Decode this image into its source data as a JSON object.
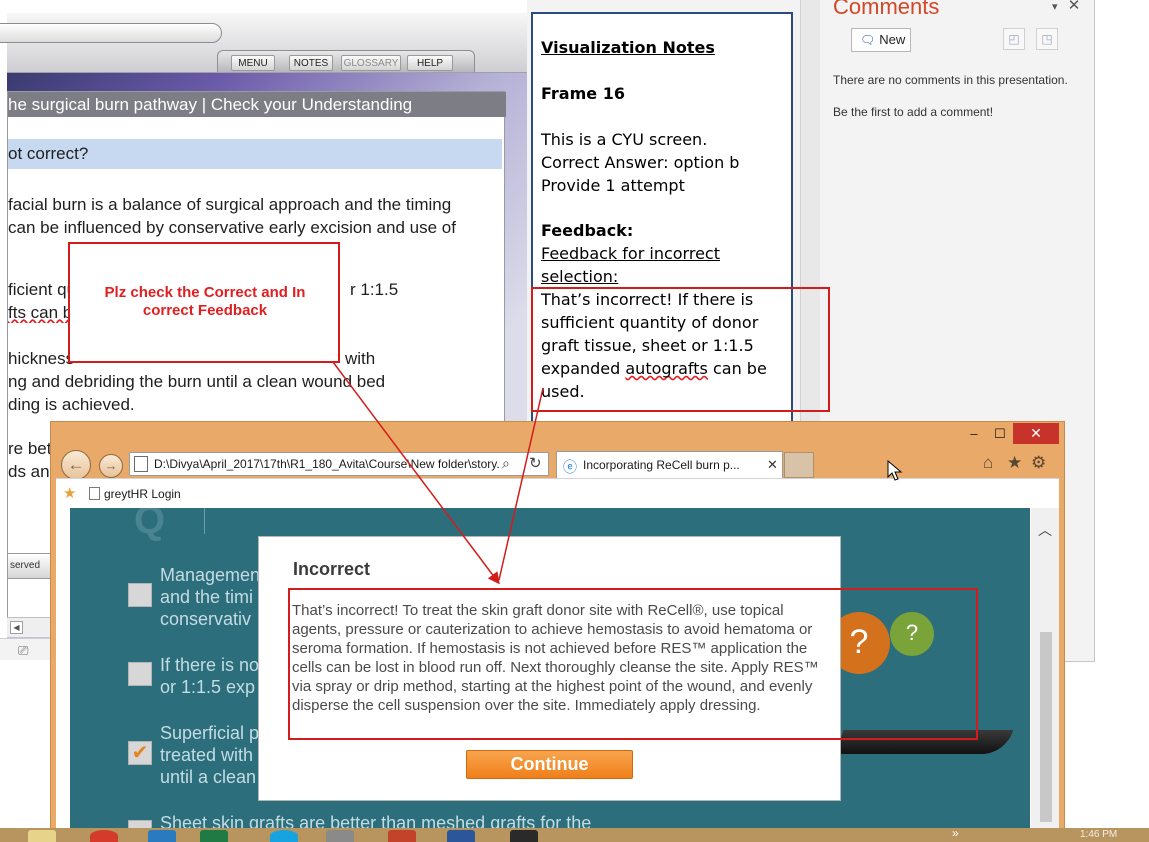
{
  "player": {
    "nav": {
      "menu": "MENU",
      "notes": "NOTES",
      "glossary": "GLOSSARY",
      "help": "HELP"
    },
    "slide_title": "he surgical burn pathway | Check your Understanding",
    "question_text": "ot correct?",
    "text_lines": [
      " facial burn is a balance of surgical approach and the timing",
      "can be influenced by conservative early excision and use of",
      "ficient qu",
      "r 1:1.5",
      "fts can b",
      "hickness",
      "with",
      "ng and debriding the burn until a clean wound bed",
      "ding is achieved.",
      "re bet",
      "ds and"
    ],
    "footer_text": "served"
  },
  "notes": {
    "heading": "Visualization Notes",
    "frame": "Frame 16",
    "line1": "This is a CYU screen.",
    "line2": "Correct Answer: option b",
    "line3": "Provide 1 attempt",
    "feedback_label": "Feedback:",
    "feedback_sub_1": "Feedback for incorrect",
    "feedback_sub_2": "selection:",
    "body_1": "That’s incorrect! If there is",
    "body_2": "sufficient quantity of donor",
    "body_3": "graft tissue, sheet or 1:1.5",
    "body_4a": "expanded ",
    "body_4b": "autografts",
    "body_4c": " can be",
    "body_5": "used."
  },
  "comments": {
    "title": "Comments",
    "new_label": "New",
    "empty_msg": "There are no comments in this presentation.",
    "prompt_msg": "Be the first to add a comment!"
  },
  "annotation": {
    "text": "Plz check the Correct and In correct Feedback"
  },
  "browser": {
    "address": "D:\\Divya\\April_2017\\17th\\R1_180_Avita\\Course\\New folder\\story.",
    "tab_title": "Incorporating ReCell burn p...",
    "favorite": "greytHR Login"
  },
  "course": {
    "options": [
      {
        "line1": "Managemen",
        "line2": "and the timi",
        "line3": "conservativ",
        "checked": false
      },
      {
        "line1": "If there is no",
        "line2": "or 1:1.5 exp",
        "checked": false
      },
      {
        "line1": "Superficial p",
        "line2": "treated with",
        "line3": "until a clean",
        "checked": true
      },
      {
        "line1": "Sheet skin grafts are better than meshed grafts for the",
        "checked": false
      }
    ]
  },
  "dialog": {
    "title": "Incorrect",
    "body": "That’s incorrect! To treat the skin graft donor site with ReCell®, use topical agents, pressure or cauterization to achieve hemostasis to avoid hematoma or seroma formation. If hemostasis is not achieved before RES™ application the cells can be lost in blood run off. Next thoroughly cleanse the site. Apply RES™ via spray or drip method, starting at the highest point of the wound, and evenly disperse the cell suspension over the site. Immediately apply dressing.",
    "continue_label": "Continue"
  },
  "taskbar": {
    "overflow": "»",
    "time": "1:46 PM"
  },
  "colors": {
    "annotation_red": "#d31c1c",
    "continue_orange": "#ef7f1a",
    "course_teal": "#2d6e7c",
    "ie_frame": "#e9a968",
    "comments_title": "#d24726"
  }
}
